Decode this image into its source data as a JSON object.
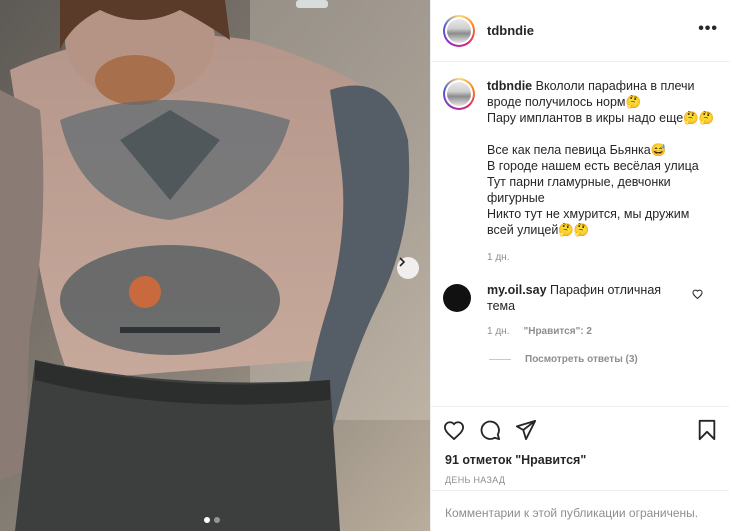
{
  "post": {
    "username": "tdbndie",
    "more_label": "•••",
    "caption_lines": [
      "Вкололи парафина в плечи вроде получилось норм🤔",
      "Пару имплантов в икры надо еще🤔🤔",
      "",
      "Все как пела певица Бьянка😅",
      "В городе нашем есть весёлая улица",
      "Тут парни гламурные, девчонки фигурные",
      "Никто тут не хмурится, мы дружим всей улицей🤔🤔"
    ],
    "caption_time": "1 дн."
  },
  "comment": {
    "username": "my.oil.say",
    "text": "Парафин отличная тема",
    "time": "1 дн.",
    "likes": "\"Нравится\": 2",
    "replies": "Посмотреть ответы (3)"
  },
  "actions": {
    "likes_text": "91 отметок",
    "likes_quote": "\"Нравится\"",
    "date": "ДЕНЬ НАЗАД",
    "comments_limited": "Комментарии к этой публикации ограничены."
  },
  "carousel": {
    "current": 1,
    "total": 2
  },
  "icons": [
    "heart-icon",
    "comment-icon",
    "share-icon",
    "bookmark-icon",
    "chevron-right-icon",
    "more-icon"
  ],
  "colors": {
    "accent_ring": "#d62976",
    "text": "#262626",
    "muted": "#8e8e8e",
    "border": "#efefef"
  }
}
